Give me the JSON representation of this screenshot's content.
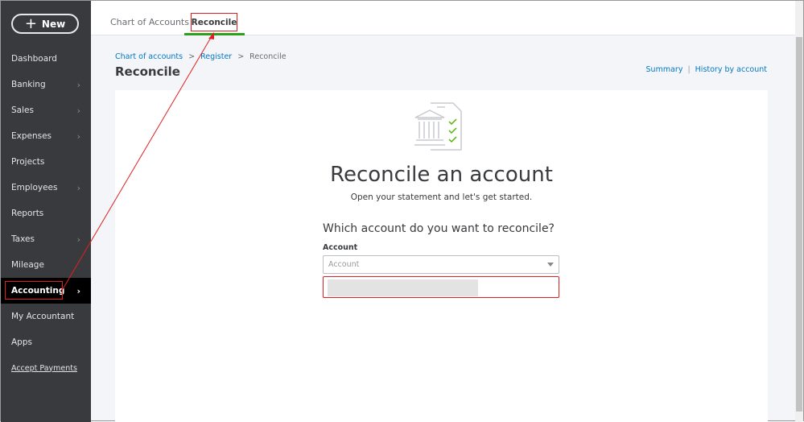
{
  "sidebar": {
    "new_label": "New",
    "items": [
      {
        "label": "Dashboard",
        "chev": false
      },
      {
        "label": "Banking",
        "chev": true
      },
      {
        "label": "Sales",
        "chev": true
      },
      {
        "label": "Expenses",
        "chev": true
      },
      {
        "label": "Projects",
        "chev": false
      },
      {
        "label": "Employees",
        "chev": true
      },
      {
        "label": "Reports",
        "chev": false
      },
      {
        "label": "Taxes",
        "chev": true
      },
      {
        "label": "Mileage",
        "chev": false
      },
      {
        "label": "Accounting",
        "chev": true,
        "active": true
      },
      {
        "label": "My Accountant",
        "chev": false
      },
      {
        "label": "Apps",
        "chev": false
      },
      {
        "label": "Accept Payments",
        "chev": false,
        "link": true
      }
    ]
  },
  "tabs": [
    "Chart of Accounts",
    "Reconcile"
  ],
  "breadcrumb": {
    "items": [
      "Chart of accounts",
      "Register",
      "Reconcile"
    ],
    "sep": ">"
  },
  "page_title": "Reconcile",
  "top_links": [
    "Summary",
    "History by account"
  ],
  "card": {
    "heading": "Reconcile an account",
    "subheading": "Open your statement and let's get started.",
    "question": "Which account do you want to reconcile?",
    "account_label": "Account",
    "account_placeholder": "Account"
  },
  "colors": {
    "accent": "#2ca01c",
    "link": "#0077c5",
    "annotation": "#e02020"
  }
}
